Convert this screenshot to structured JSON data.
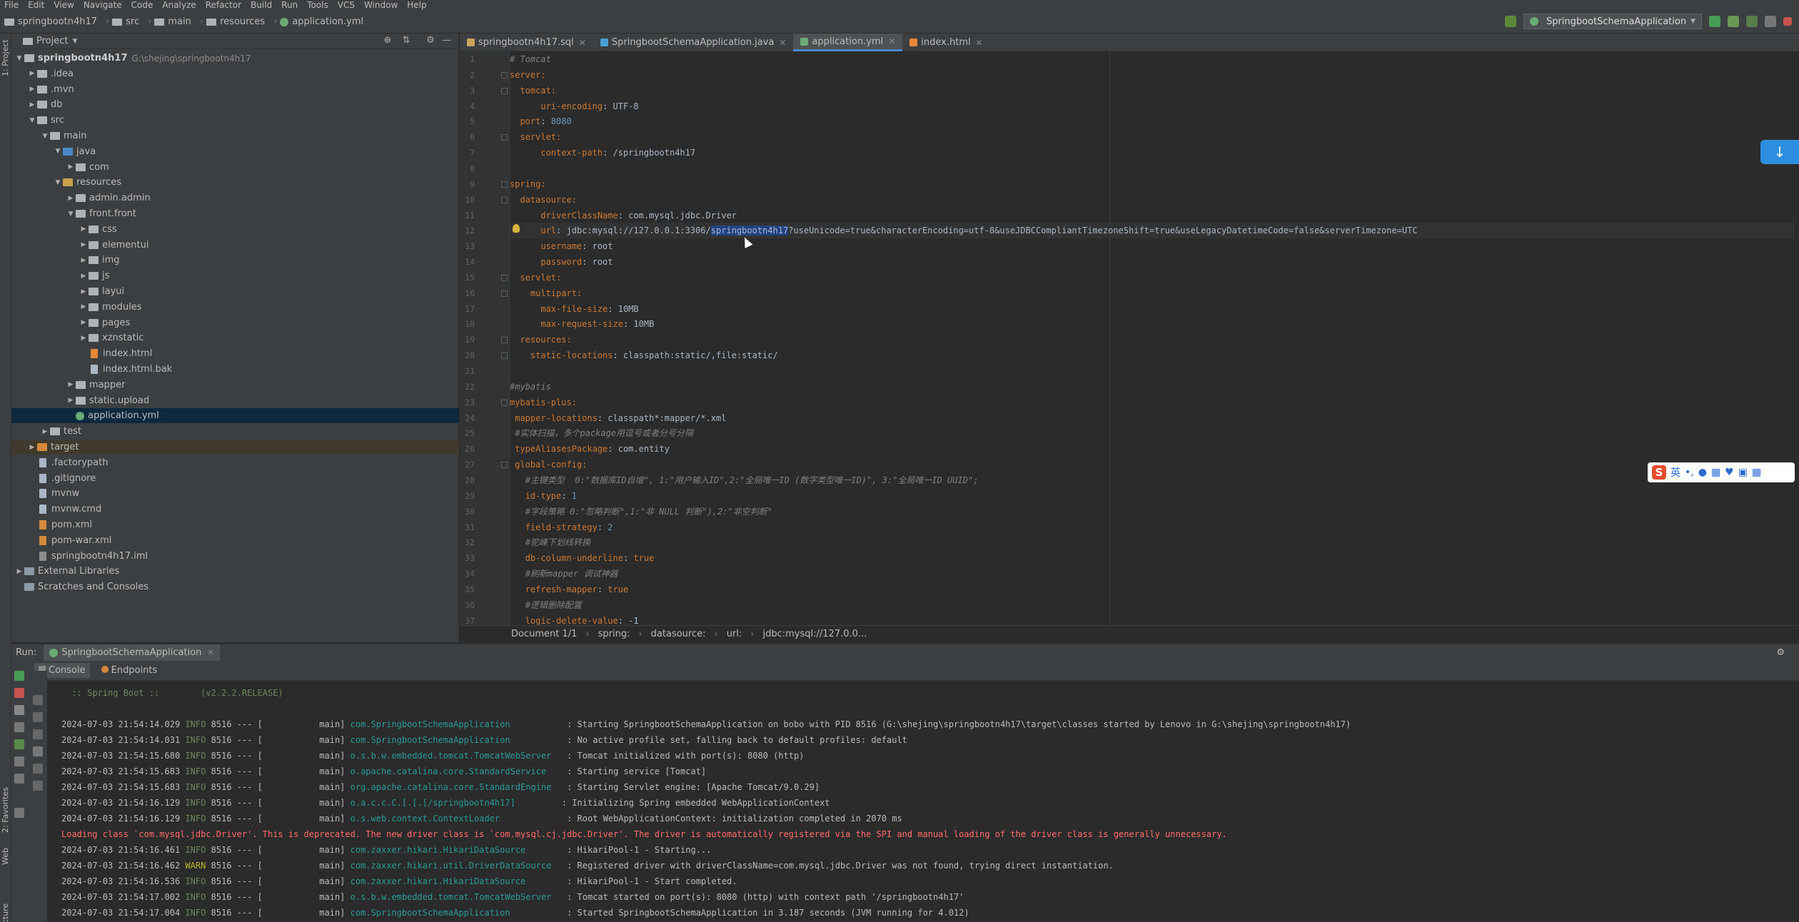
{
  "menu": [
    "File",
    "Edit",
    "View",
    "Navigate",
    "Code",
    "Analyze",
    "Refactor",
    "Build",
    "Run",
    "Tools",
    "VCS",
    "Window",
    "Help"
  ],
  "breadcrumb": [
    "springbootn4h17",
    "src",
    "main",
    "resources",
    "application.yml"
  ],
  "run_config": "SpringbootSchemaApplication",
  "left_strip": {
    "project": "1: Project",
    "favorites": "2: Favorites",
    "web": "Web",
    "structure": "Structure"
  },
  "project": {
    "header": "Project",
    "root_name": "springbootn4h17",
    "root_path": "G:\\shejing\\springbootn4h17",
    "items": [
      {
        "label": ".idea",
        "depth": 1,
        "arrow": "▶",
        "kind": "folder"
      },
      {
        "label": ".mvn",
        "depth": 1,
        "arrow": "▶",
        "kind": "folder"
      },
      {
        "label": "db",
        "depth": 1,
        "arrow": "▶",
        "kind": "folder"
      },
      {
        "label": "src",
        "depth": 1,
        "arrow": "▼",
        "kind": "folder"
      },
      {
        "label": "main",
        "depth": 2,
        "arrow": "▼",
        "kind": "folder"
      },
      {
        "label": "java",
        "depth": 3,
        "arrow": "▼",
        "kind": "src"
      },
      {
        "label": "com",
        "depth": 4,
        "arrow": "▶",
        "kind": "folder"
      },
      {
        "label": "resources",
        "depth": 3,
        "arrow": "▼",
        "kind": "res"
      },
      {
        "label": "admin.admin",
        "depth": 4,
        "arrow": "▶",
        "kind": "folder"
      },
      {
        "label": "front.front",
        "depth": 4,
        "arrow": "▼",
        "kind": "folder"
      },
      {
        "label": "css",
        "depth": 5,
        "arrow": "▶",
        "kind": "folder"
      },
      {
        "label": "elementui",
        "depth": 5,
        "arrow": "▶",
        "kind": "folder"
      },
      {
        "label": "img",
        "depth": 5,
        "arrow": "▶",
        "kind": "folder"
      },
      {
        "label": "js",
        "depth": 5,
        "arrow": "▶",
        "kind": "folder"
      },
      {
        "label": "layui",
        "depth": 5,
        "arrow": "▶",
        "kind": "folder"
      },
      {
        "label": "modules",
        "depth": 5,
        "arrow": "▶",
        "kind": "folder"
      },
      {
        "label": "pages",
        "depth": 5,
        "arrow": "▶",
        "kind": "folder"
      },
      {
        "label": "xznstatic",
        "depth": 5,
        "arrow": "▶",
        "kind": "folder"
      },
      {
        "label": "index.html",
        "depth": 5,
        "arrow": "",
        "kind": "html"
      },
      {
        "label": "index.html.bak",
        "depth": 5,
        "arrow": "",
        "kind": "file"
      },
      {
        "label": "mapper",
        "depth": 4,
        "arrow": "▶",
        "kind": "folder"
      },
      {
        "label": "static.upload",
        "depth": 4,
        "arrow": "▶",
        "kind": "folder"
      },
      {
        "label": "application.yml",
        "depth": 4,
        "arrow": "",
        "kind": "yml",
        "selected": true
      },
      {
        "label": "test",
        "depth": 2,
        "arrow": "▶",
        "kind": "folder"
      },
      {
        "label": "target",
        "depth": 1,
        "arrow": "▶",
        "kind": "excluded"
      },
      {
        "label": ".factorypath",
        "depth": 1,
        "arrow": "",
        "kind": "file"
      },
      {
        "label": ".gitignore",
        "depth": 1,
        "arrow": "",
        "kind": "file"
      },
      {
        "label": "mvnw",
        "depth": 1,
        "arrow": "",
        "kind": "file"
      },
      {
        "label": "mvnw.cmd",
        "depth": 1,
        "arrow": "",
        "kind": "file"
      },
      {
        "label": "pom.xml",
        "depth": 1,
        "arrow": "",
        "kind": "xml"
      },
      {
        "label": "pom-war.xml",
        "depth": 1,
        "arrow": "",
        "kind": "xml"
      },
      {
        "label": "springbootn4h17.iml",
        "depth": 1,
        "arrow": "",
        "kind": "iml"
      },
      {
        "label": "External Libraries",
        "depth": 0,
        "arrow": "▶",
        "kind": "lib"
      },
      {
        "label": "Scratches and Consoles",
        "depth": 0,
        "arrow": "",
        "kind": "lib"
      }
    ]
  },
  "tabs": [
    {
      "label": "springbootn4h17.sql",
      "color": "#c7a35e",
      "active": false
    },
    {
      "label": "SpringbootSchemaApplication.java",
      "color": "#4a9fd5",
      "active": false
    },
    {
      "label": "application.yml",
      "color": "#6aab73",
      "active": true
    },
    {
      "label": "index.html",
      "color": "#e8883a",
      "active": false
    }
  ],
  "code_lines": [
    {
      "n": "1",
      "t": [
        [
          "c",
          "# Tomcat"
        ]
      ]
    },
    {
      "n": "2",
      "t": [
        [
          "k",
          "server:"
        ]
      ]
    },
    {
      "n": "3",
      "t": [
        [
          "",
          "  "
        ],
        [
          "k",
          "tomcat:"
        ]
      ]
    },
    {
      "n": "4",
      "t": [
        [
          "",
          "      "
        ],
        [
          "k",
          "uri-encoding"
        ],
        [
          "v",
          ": UTF-8"
        ]
      ]
    },
    {
      "n": "5",
      "t": [
        [
          "",
          "  "
        ],
        [
          "k",
          "port"
        ],
        [
          "v",
          ": "
        ],
        [
          "n",
          "8080"
        ]
      ]
    },
    {
      "n": "6",
      "t": [
        [
          "",
          "  "
        ],
        [
          "k",
          "servlet:"
        ]
      ]
    },
    {
      "n": "7",
      "t": [
        [
          "",
          "      "
        ],
        [
          "k",
          "context-path"
        ],
        [
          "v",
          ": /springbootn4h17"
        ]
      ]
    },
    {
      "n": "8",
      "t": []
    },
    {
      "n": "9",
      "t": [
        [
          "k",
          "spring:"
        ]
      ]
    },
    {
      "n": "10",
      "t": [
        [
          "",
          "  "
        ],
        [
          "k",
          "datasource:"
        ]
      ]
    },
    {
      "n": "11",
      "t": [
        [
          "",
          "      "
        ],
        [
          "k",
          "driverClassName"
        ],
        [
          "v",
          ": com.mysql.jdbc.Driver"
        ]
      ]
    },
    {
      "n": "12",
      "t": [
        [
          "",
          "      "
        ],
        [
          "k",
          "url"
        ],
        [
          "v",
          ": jdbc:mysql://127.0.0.1:3306/"
        ],
        [
          "s",
          "springbootn4h17"
        ],
        [
          "v",
          "?useUnicode=true&characterEncoding=utf-8&useJDBCCompliantTimezoneShift=true&useLegacyDatetimeCode=false&serverTimezone=UTC"
        ]
      ],
      "current": true
    },
    {
      "n": "13",
      "t": [
        [
          "",
          "      "
        ],
        [
          "k",
          "username"
        ],
        [
          "v",
          ": root"
        ]
      ]
    },
    {
      "n": "14",
      "t": [
        [
          "",
          "      "
        ],
        [
          "k",
          "password"
        ],
        [
          "v",
          ": root"
        ]
      ]
    },
    {
      "n": "15",
      "t": [
        [
          "",
          "  "
        ],
        [
          "k",
          "servlet:"
        ]
      ]
    },
    {
      "n": "16",
      "t": [
        [
          "",
          "    "
        ],
        [
          "k",
          "multipart:"
        ]
      ]
    },
    {
      "n": "17",
      "t": [
        [
          "",
          "      "
        ],
        [
          "k",
          "max-file-size"
        ],
        [
          "v",
          ": 10MB"
        ]
      ]
    },
    {
      "n": "18",
      "t": [
        [
          "",
          "      "
        ],
        [
          "k",
          "max-request-size"
        ],
        [
          "v",
          ": 10MB"
        ]
      ]
    },
    {
      "n": "19",
      "t": [
        [
          "",
          "  "
        ],
        [
          "k",
          "resources:"
        ]
      ]
    },
    {
      "n": "20",
      "t": [
        [
          "",
          "    "
        ],
        [
          "k",
          "static-locations"
        ],
        [
          "v",
          ": classpath:static/,file:static/"
        ]
      ]
    },
    {
      "n": "21",
      "t": []
    },
    {
      "n": "22",
      "t": [
        [
          "c",
          "#mybatis"
        ]
      ]
    },
    {
      "n": "23",
      "t": [
        [
          "k",
          "mybatis-plus:"
        ]
      ]
    },
    {
      "n": "24",
      "t": [
        [
          "",
          " "
        ],
        [
          "k",
          "mapper-locations"
        ],
        [
          "v",
          ": classpath*:mapper/*.xml"
        ]
      ]
    },
    {
      "n": "25",
      "t": [
        [
          "",
          " "
        ],
        [
          "c",
          "#实体扫描，多个package用逗号或者分号分隔"
        ]
      ]
    },
    {
      "n": "26",
      "t": [
        [
          "",
          " "
        ],
        [
          "k",
          "typeAliasesPackage"
        ],
        [
          "v",
          ": com.entity"
        ]
      ]
    },
    {
      "n": "27",
      "t": [
        [
          "",
          " "
        ],
        [
          "k",
          "global-config:"
        ]
      ]
    },
    {
      "n": "28",
      "t": [
        [
          "",
          "   "
        ],
        [
          "c",
          "#主键类型  0:\"数据库ID自增\", 1:\"用户输入ID\",2:\"全局唯一ID (数字类型唯一ID)\", 3:\"全局唯一ID UUID\";"
        ]
      ]
    },
    {
      "n": "29",
      "t": [
        [
          "",
          "   "
        ],
        [
          "k",
          "id-type"
        ],
        [
          "v",
          ": "
        ],
        [
          "n",
          "1"
        ]
      ]
    },
    {
      "n": "30",
      "t": [
        [
          "",
          "   "
        ],
        [
          "c",
          "#字段策略 0:\"忽略判断\",1:\"非 NULL 判断\"),2:\"非空判断\""
        ]
      ]
    },
    {
      "n": "31",
      "t": [
        [
          "",
          "   "
        ],
        [
          "k",
          "field-strategy"
        ],
        [
          "v",
          ": "
        ],
        [
          "n",
          "2"
        ]
      ]
    },
    {
      "n": "32",
      "t": [
        [
          "",
          "   "
        ],
        [
          "c",
          "#驼峰下划线转换"
        ]
      ]
    },
    {
      "n": "33",
      "t": [
        [
          "",
          "   "
        ],
        [
          "k",
          "db-column-underline"
        ],
        [
          "v",
          ": "
        ],
        [
          "k",
          "true"
        ]
      ]
    },
    {
      "n": "34",
      "t": [
        [
          "",
          "   "
        ],
        [
          "c",
          "#刷新mapper 调试神器"
        ]
      ]
    },
    {
      "n": "35",
      "t": [
        [
          "",
          "   "
        ],
        [
          "k",
          "refresh-mapper"
        ],
        [
          "v",
          ": "
        ],
        [
          "k",
          "true"
        ]
      ]
    },
    {
      "n": "36",
      "t": [
        [
          "",
          "   "
        ],
        [
          "c",
          "#逻辑删除配置"
        ]
      ]
    },
    {
      "n": "37",
      "t": [
        [
          "",
          "   "
        ],
        [
          "k",
          "logic-delete-value"
        ],
        [
          "v",
          ": -1"
        ]
      ]
    }
  ],
  "editor_status": [
    "Document 1/1",
    "spring:",
    "datasource:",
    "url:",
    "jdbc:mysql://127.0.0..."
  ],
  "ime": {
    "logo": "S",
    "mode": "英"
  },
  "run": {
    "label": "Run:",
    "tab": "SpringbootSchemaApplication",
    "subtabs": [
      "Console",
      "Endpoints"
    ],
    "console_lines": [
      {
        "type": "plain",
        "text": "  :: Spring Boot ::        (v2.2.2.RELEASE)"
      },
      {
        "type": "plain",
        "text": ""
      },
      {
        "type": "log",
        "ts": "2024-07-03 21:54:14.029",
        "lvl": "INFO",
        "pid": "8516 --- [           main]",
        "cls": "com.SpringbootSchemaApplication          ",
        "msg": ": Starting SpringbootSchemaApplication on bobo with PID 8516 (G:\\shejing\\springbootn4h17\\target\\classes started by Lenovo in G:\\shejing\\springbootn4h17)"
      },
      {
        "type": "log",
        "ts": "2024-07-03 21:54:14.031",
        "lvl": "INFO",
        "pid": "8516 --- [           main]",
        "cls": "com.SpringbootSchemaApplication          ",
        "msg": ": No active profile set, falling back to default profiles: default"
      },
      {
        "type": "log",
        "ts": "2024-07-03 21:54:15.680",
        "lvl": "INFO",
        "pid": "8516 --- [           main]",
        "cls": "o.s.b.w.embedded.tomcat.TomcatWebServer  ",
        "msg": ": Tomcat initialized with port(s): 8080 (http)"
      },
      {
        "type": "log",
        "ts": "2024-07-03 21:54:15.683",
        "lvl": "INFO",
        "pid": "8516 --- [           main]",
        "cls": "o.apache.catalina.core.StandardService   ",
        "msg": ": Starting service [Tomcat]"
      },
      {
        "type": "log",
        "ts": "2024-07-03 21:54:15.683",
        "lvl": "INFO",
        "pid": "8516 --- [           main]",
        "cls": "org.apache.catalina.core.StandardEngine  ",
        "msg": ": Starting Servlet engine: [Apache Tomcat/9.0.29]"
      },
      {
        "type": "log",
        "ts": "2024-07-03 21:54:16.129",
        "lvl": "INFO",
        "pid": "8516 --- [           main]",
        "cls": "o.a.c.c.C.[.[.[/springbootn4h17]        ",
        "msg": ": Initializing Spring embedded WebApplicationContext"
      },
      {
        "type": "log",
        "ts": "2024-07-03 21:54:16.129",
        "lvl": "INFO",
        "pid": "8516 --- [           main]",
        "cls": "o.s.web.context.ContextLoader            ",
        "msg": ": Root WebApplicationContext: initialization completed in 2070 ms"
      },
      {
        "type": "err",
        "text": "Loading class `com.mysql.jdbc.Driver'. This is deprecated. The new driver class is `com.mysql.cj.jdbc.Driver'. The driver is automatically registered via the SPI and manual loading of the driver class is generally unnecessary."
      },
      {
        "type": "log",
        "ts": "2024-07-03 21:54:16.461",
        "lvl": "INFO",
        "pid": "8516 --- [           main]",
        "cls": "com.zaxxer.hikari.HikariDataSource       ",
        "msg": ": HikariPool-1 - Starting..."
      },
      {
        "type": "log",
        "ts": "2024-07-03 21:54:16.462",
        "lvl": "WARN",
        "pid": "8516 --- [           main]",
        "cls": "com.zaxxer.hikari.util.DriverDataSource  ",
        "msg": ": Registered driver with driverClassName=com.mysql.jdbc.Driver was not found, trying direct instantiation."
      },
      {
        "type": "log",
        "ts": "2024-07-03 21:54:16.536",
        "lvl": "INFO",
        "pid": "8516 --- [           main]",
        "cls": "com.zaxxer.hikari.HikariDataSource       ",
        "msg": ": HikariPool-1 - Start completed."
      },
      {
        "type": "log",
        "ts": "2024-07-03 21:54:17.002",
        "lvl": "INFO",
        "pid": "8516 --- [           main]",
        "cls": "o.s.b.w.embedded.tomcat.TomcatWebServer  ",
        "msg": ": Tomcat started on port(s): 8080 (http) with context path '/springbootn4h17'"
      },
      {
        "type": "log",
        "ts": "2024-07-03 21:54:17.004",
        "lvl": "INFO",
        "pid": "8516 --- [           main]",
        "cls": "com.SpringbootSchemaApplication          ",
        "msg": ": Started SpringbootSchemaApplication in 3.187 seconds (JVM running for 4.012)"
      }
    ]
  }
}
